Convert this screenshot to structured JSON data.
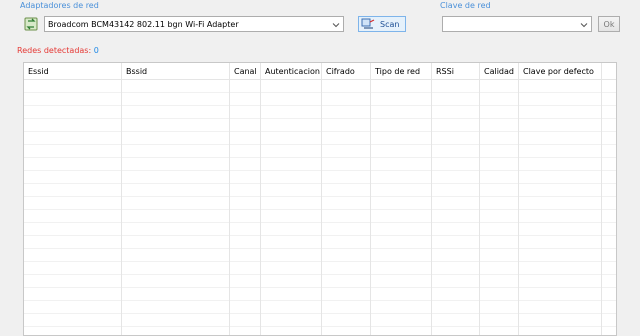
{
  "adapters": {
    "label": "Adaptadores de red",
    "selected": "Broadcom BCM43142 802.11 bgn Wi-Fi Adapter",
    "icon": "network-adapter-icon"
  },
  "scan_button": {
    "label": "Scan",
    "icon": "scan-network-icon"
  },
  "key": {
    "label": "Clave de red",
    "value": "",
    "ok_label": "Ok"
  },
  "detected": {
    "label": "Redes detectadas:",
    "count": "0"
  },
  "table": {
    "columns": [
      "Essid",
      "Bssid",
      "Canal",
      "Autenticacion",
      "Cifrado",
      "Tipo de red",
      "RSSi",
      "Calidad",
      "Clave por defecto"
    ],
    "rows": []
  },
  "colors": {
    "label_blue": "#4a90d9",
    "label_red": "#e53935",
    "count_blue": "#1e88e5"
  }
}
